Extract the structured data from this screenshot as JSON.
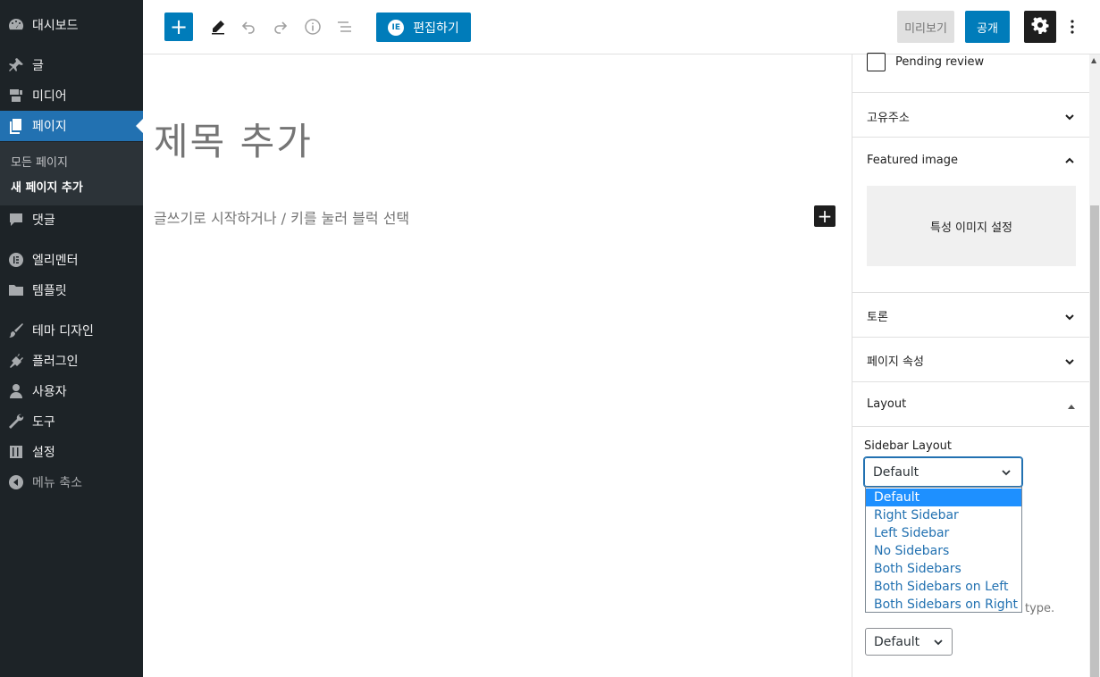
{
  "admin_menu": {
    "items": [
      {
        "label": "대시보드",
        "icon": "dashboard-icon"
      },
      {
        "label": "글",
        "icon": "pin-icon"
      },
      {
        "label": "미디어",
        "icon": "media-icon"
      },
      {
        "label": "페이지",
        "icon": "page-icon"
      },
      {
        "label": "댓글",
        "icon": "comment-icon"
      },
      {
        "label": "엘리멘터",
        "icon": "elementor-icon"
      },
      {
        "label": "템플릿",
        "icon": "folder-icon"
      },
      {
        "label": "테마 디자인",
        "icon": "brush-icon"
      },
      {
        "label": "플러그인",
        "icon": "plugin-icon"
      },
      {
        "label": "사용자",
        "icon": "user-icon"
      },
      {
        "label": "도구",
        "icon": "wrench-icon"
      },
      {
        "label": "설정",
        "icon": "settings-sliders-icon"
      },
      {
        "label": "메뉴 축소",
        "icon": "collapse-icon"
      }
    ],
    "submenu": [
      "모든 페이지",
      "새 페이지 추가"
    ],
    "active_index": 3
  },
  "toolbar": {
    "add_label": "+",
    "edit_label": "편집하기",
    "edit_badge": "IE",
    "preview_label": "미리보기",
    "publish_label": "공개"
  },
  "editor": {
    "title_placeholder": "제목 추가",
    "block_placeholder": "글쓰기로 시작하거나 / 키를 눌러 블럭 선택",
    "inline_add_label": "+"
  },
  "settings": {
    "pending_review": "Pending review",
    "permalink": "고유주소",
    "featured_image": "Featured image",
    "featured_placeholder": "특성 이미지 설정",
    "discussion": "토론",
    "page_attributes": "페이지 속성",
    "layout": "Layout",
    "sidebar_layout_label": "Sidebar Layout",
    "sidebar_layout_value": "Default",
    "sidebar_layout_options": [
      "Default",
      "Right Sidebar",
      "Left Sidebar",
      "No Sidebars",
      "Both Sidebars",
      "Both Sidebars on Left",
      "Both Sidebars on Right"
    ],
    "behind_text": "type.",
    "second_select_value": "Default"
  },
  "colors": {
    "admin_bg": "#1d2327",
    "accent": "#007cba",
    "active_menu": "#2271b1"
  }
}
